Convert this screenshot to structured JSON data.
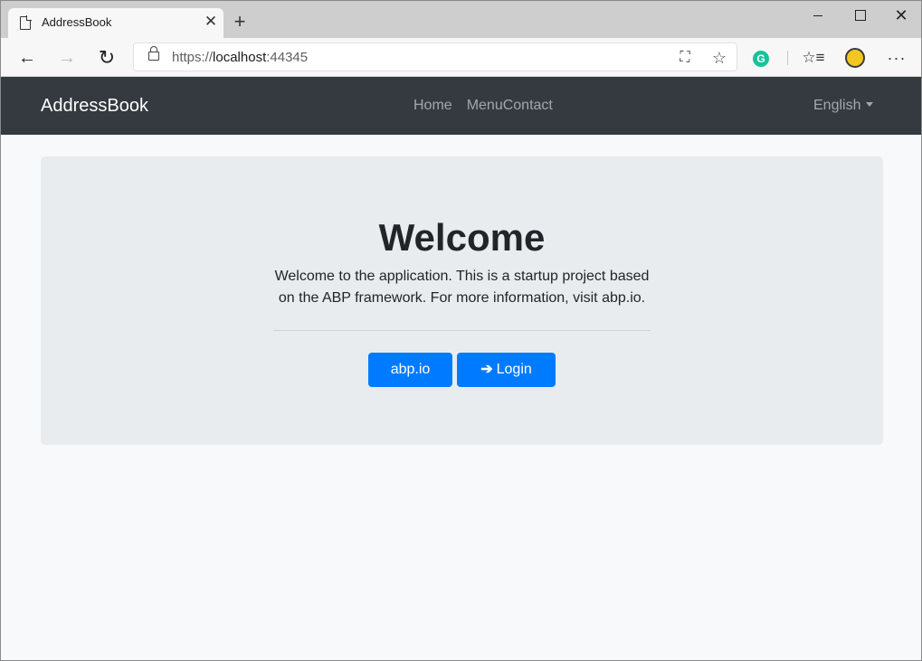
{
  "browser": {
    "tab_title": "AddressBook",
    "url_scheme": "https://",
    "url_host": "localhost",
    "url_port": ":44345",
    "icons": [
      "page-icon",
      "close-icon",
      "plus-icon",
      "back-arrow-icon",
      "forward-arrow-icon",
      "refresh-icon",
      "lock-icon",
      "translate-icon",
      "star-icon",
      "grammarly-icon",
      "favorites-icon",
      "avatar",
      "more-icon"
    ],
    "glyphs": {
      "close": "✕",
      "new_tab": "+",
      "back": "←",
      "forward": "→",
      "refresh": "↻",
      "translate": "⛶",
      "star": "☆",
      "grammarly": "G",
      "favorites": "☆≡",
      "more": "···",
      "minimize": "",
      "maximize": "",
      "window_close": "✕"
    }
  },
  "navbar": {
    "brand": "AddressBook",
    "links": [
      "Home",
      "MenuContact"
    ],
    "language": "English"
  },
  "hero": {
    "title": "Welcome",
    "text": "Welcome to the application. This is a startup project based on the ABP framework. For more information, visit abp.io.",
    "btn_abp": "abp.io",
    "btn_login": "Login",
    "signin_glyph": "➔"
  },
  "colors": {
    "navbar_bg": "#343a40",
    "primary": "#007bff",
    "jumbotron_bg": "#e9ecef",
    "page_bg": "#f8f9fa"
  }
}
